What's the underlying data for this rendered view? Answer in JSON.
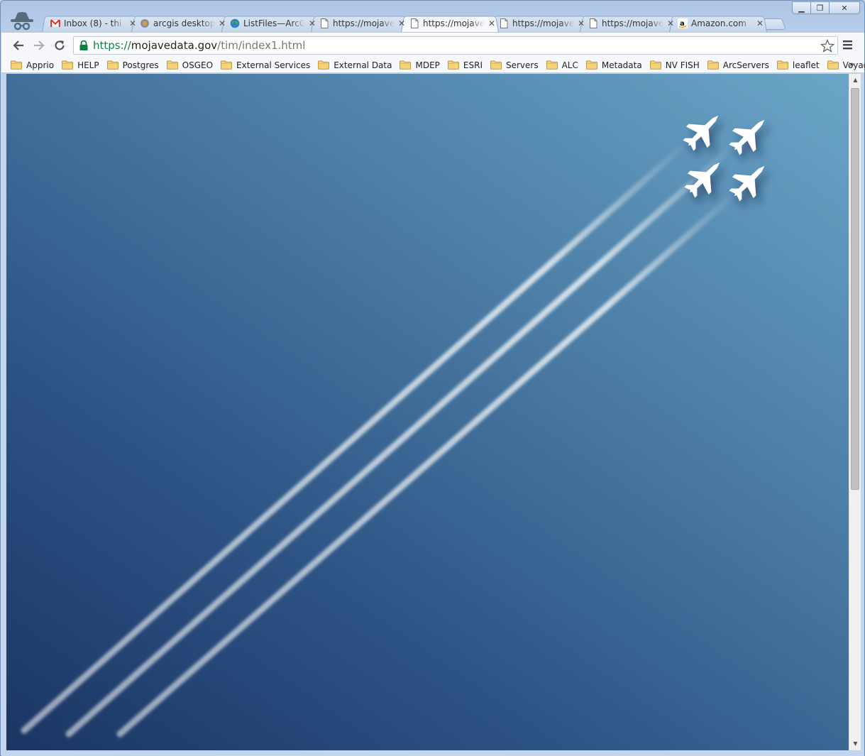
{
  "window": {
    "controls": {
      "minimize": "▁",
      "maximize": "❐",
      "close": "✕"
    }
  },
  "tabs": [
    {
      "title": "Inbox (8) - thi",
      "icon": "gmail-icon",
      "active": false
    },
    {
      "title": "arcgis desktop",
      "icon": "arcgis-icon",
      "active": false
    },
    {
      "title": "ListFiles—ArcG",
      "icon": "globe-icon",
      "active": false
    },
    {
      "title": "https://mojave",
      "icon": "page-icon",
      "active": false
    },
    {
      "title": "https://mojave",
      "icon": "page-icon",
      "active": true
    },
    {
      "title": "https://mojave",
      "icon": "page-icon",
      "active": false
    },
    {
      "title": "https://mojave",
      "icon": "page-icon",
      "active": false
    },
    {
      "title": "Amazon.com",
      "icon": "amazon-icon",
      "active": false
    }
  ],
  "omnibox": {
    "scheme": "https://",
    "host": "mojavedata.gov",
    "path": "/tim/index1.html"
  },
  "bookmarks": [
    "Apprio",
    "HELP",
    "Postgres",
    "OSGEO",
    "External Services",
    "External Data",
    "MDEP",
    "ESRI",
    "Servers",
    "ALC",
    "Metadata",
    "NV FISH",
    "ArcServers",
    "leaflet",
    "Voyager"
  ],
  "bookmarks_overflow": "»",
  "page": {
    "description_icon": "jet-formation-icon",
    "background_colors": [
      "#1b3563",
      "#2c5283",
      "#4a7aa3",
      "#6aa6c8"
    ]
  }
}
